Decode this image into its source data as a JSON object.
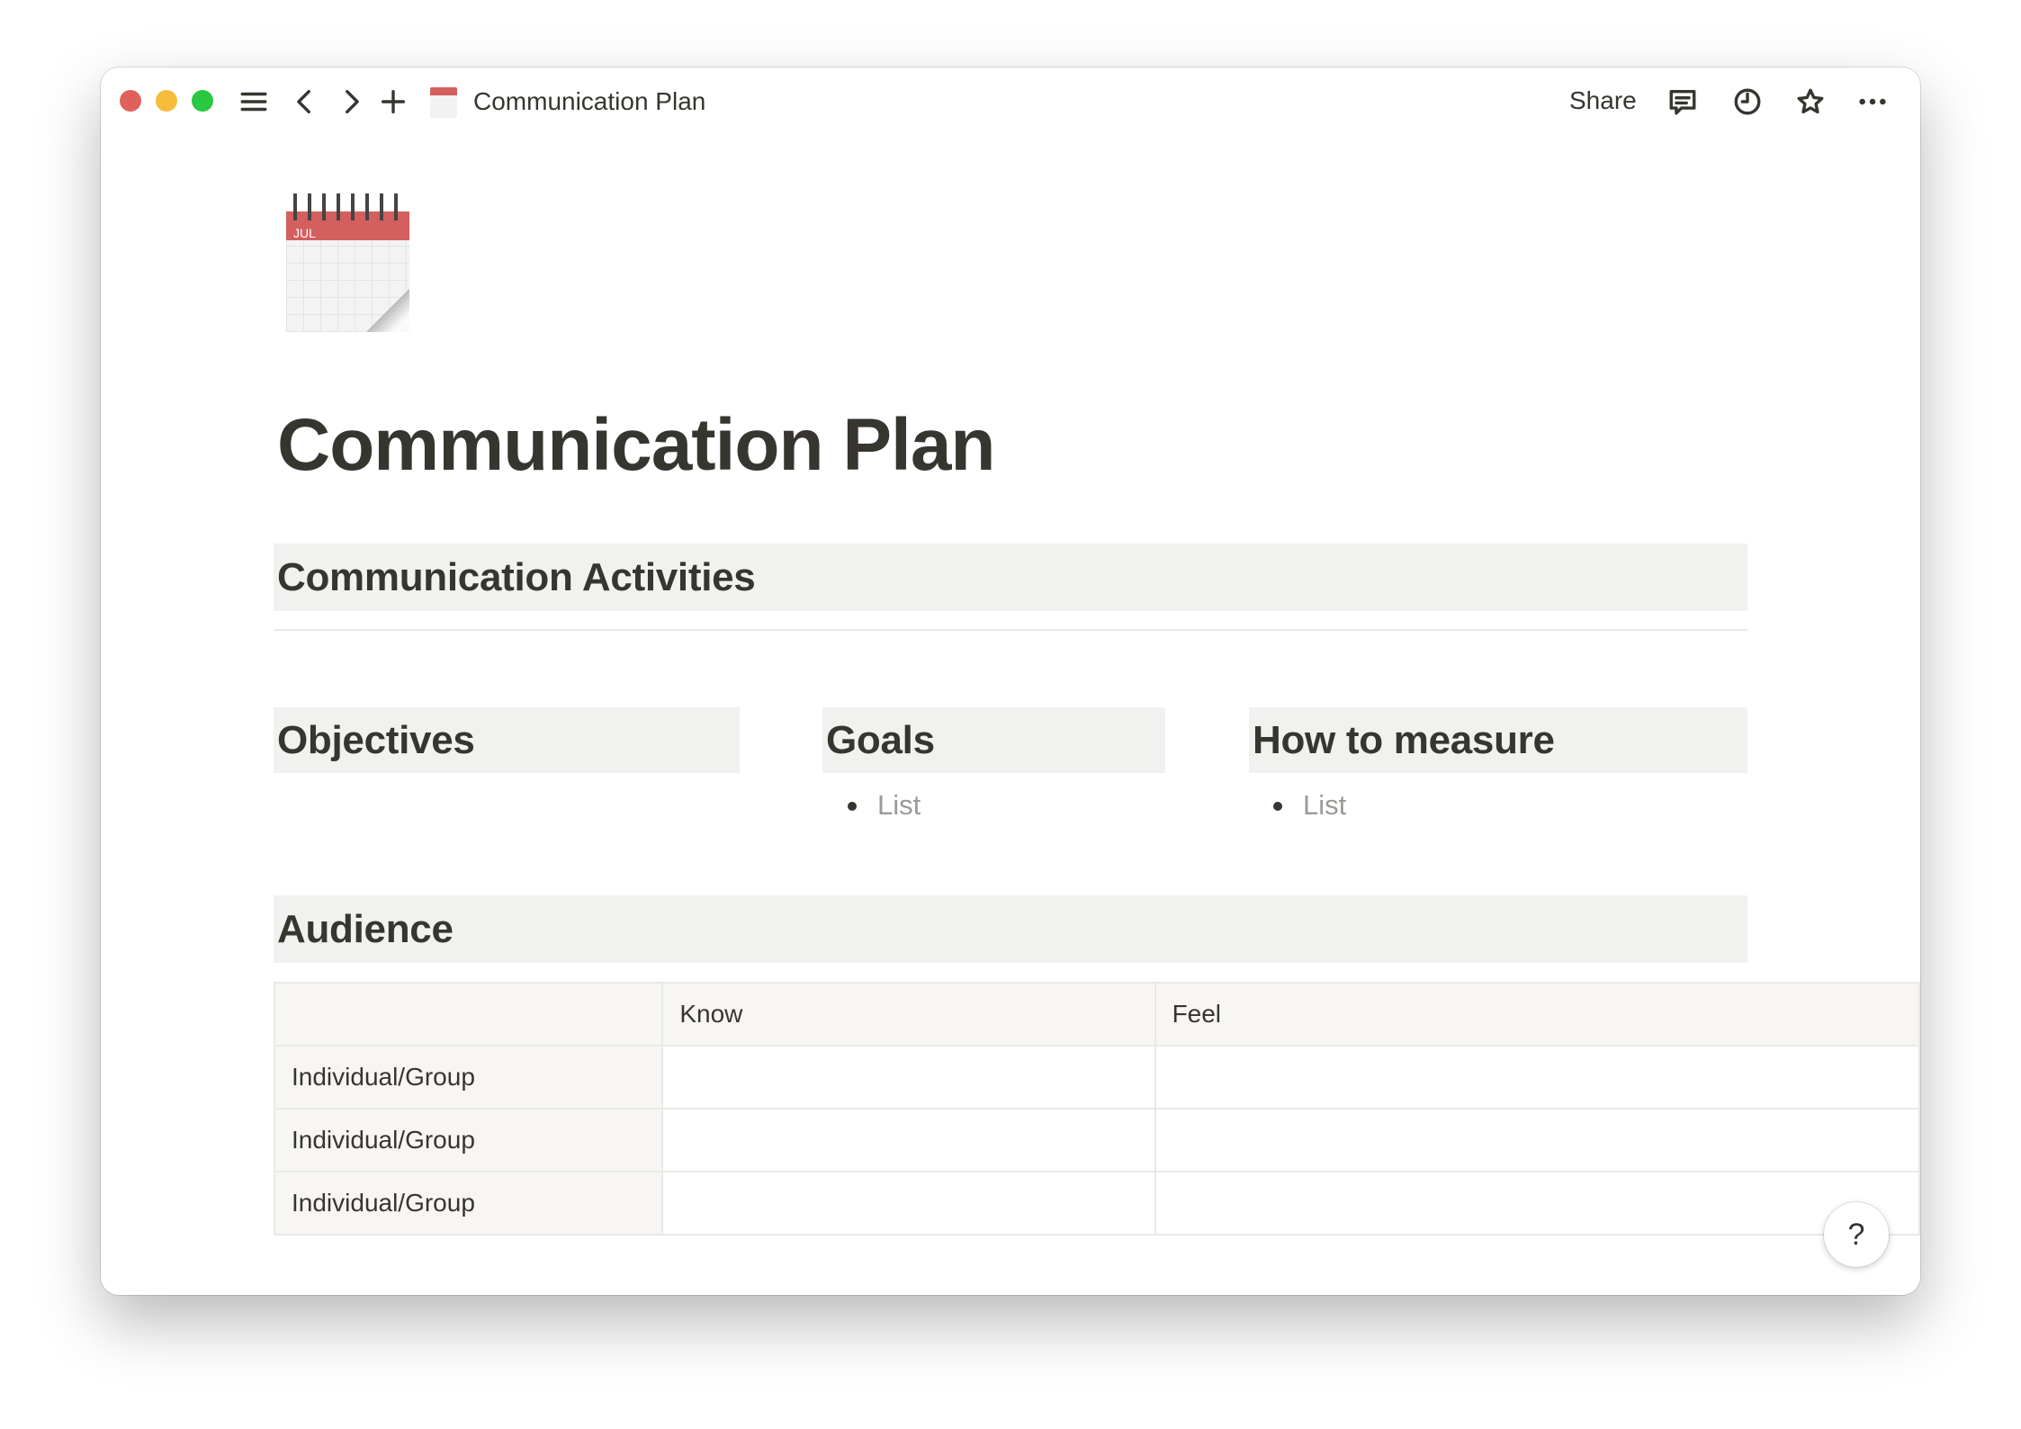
{
  "window": {
    "traffic_lights": {
      "close": "#e0615a",
      "minimize": "#f6bd3b",
      "maximize": "#29c840"
    }
  },
  "topbar": {
    "page_title": "Communication Plan",
    "page_icon": "spiral-calendar-icon",
    "share_label": "Share",
    "icons": [
      "menu-icon",
      "back-icon",
      "forward-icon",
      "plus-icon",
      "comment-icon",
      "history-clock-icon",
      "favorite-star-icon",
      "more-icon"
    ]
  },
  "page": {
    "icon": "spiral-calendar-icon",
    "icon_month_text": "JUL",
    "title": "Communication Plan",
    "section_activities": "Communication Activities",
    "columns": [
      {
        "heading": "Objectives",
        "bullets": []
      },
      {
        "heading": "Goals",
        "bullets": [
          "List"
        ]
      },
      {
        "heading": "How to measure",
        "bullets": [
          "List"
        ]
      }
    ],
    "section_audience": "Audience",
    "table": {
      "headers": [
        "",
        "Know",
        "Feel"
      ],
      "rows": [
        [
          "Individual/Group",
          "",
          ""
        ],
        [
          "Individual/Group",
          "",
          ""
        ],
        [
          "Individual/Group",
          "",
          ""
        ]
      ]
    }
  },
  "help_label": "?",
  "colors": {
    "heading_bg": "#f1f1ef",
    "table_header_bg": "#f7f6f3",
    "text": "#37352f",
    "placeholder": "#9b9a97"
  }
}
